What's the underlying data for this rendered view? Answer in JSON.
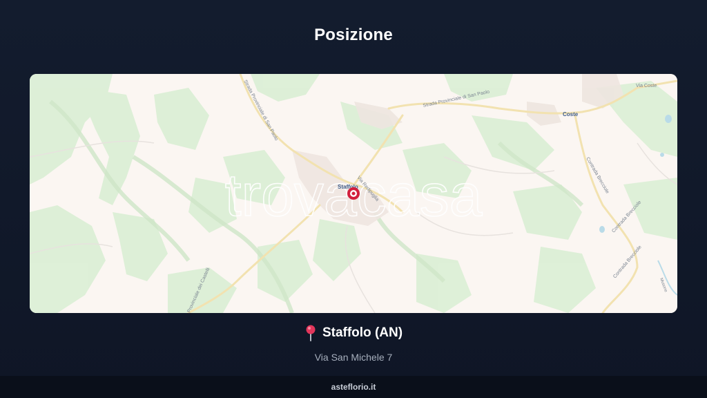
{
  "header": {
    "title": "Posizione"
  },
  "map": {
    "watermark": "trovacasa",
    "labels": {
      "staffolo": "Staffolo",
      "coste": "Coste",
      "via_coste": "Via Coste",
      "sp_san_paolo_north": "Strada Provinciale di San Paolo",
      "sp_san_paolo_east": "Strada Provinciale di San Paolo",
      "via_redipuglia": "Via Redipuglia",
      "contrada_brecciole_1": "Contrada Brecciole",
      "contrada_brecciole_2": "Contrada Brecciole",
      "contrada_brecciole_3": "Contrada Brecciole",
      "sp_castelli": "Provinciale dei Castelli",
      "musone": "Musone"
    },
    "marker_icon": "map-marker-icon",
    "colors": {
      "land": "#fbf6f2",
      "forest": "#dcefd6",
      "road": "#f7e6b6",
      "water": "#b9dbe8",
      "marker": "#d21f3c"
    }
  },
  "location": {
    "pin_icon": "pushpin-icon",
    "name": "Staffolo (AN)",
    "address": "Via San Michele 7"
  },
  "footer": {
    "site": "asteflorio.it"
  }
}
